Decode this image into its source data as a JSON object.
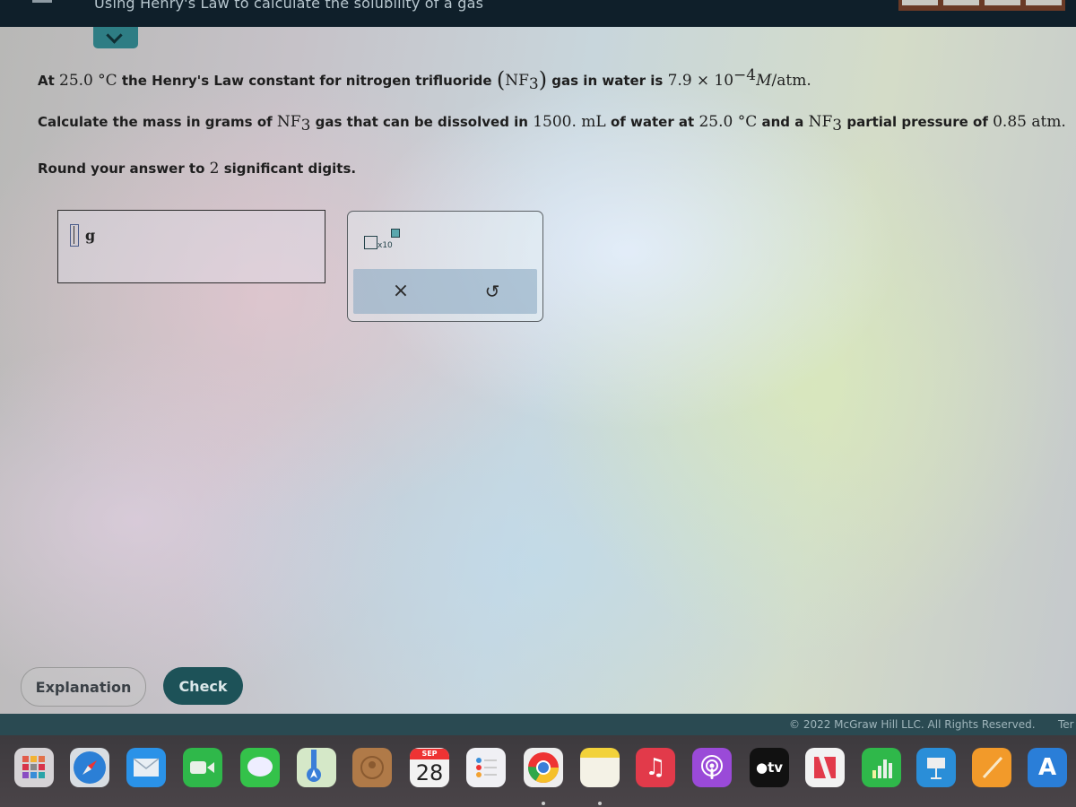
{
  "header": {
    "title": "Using Henry's Law to calculate the solubility of a gas"
  },
  "question": {
    "line1": {
      "prefix": "At",
      "temp": "25.0",
      "temp_unit": "°C",
      "text_a": "the Henry's Law constant for nitrogen trifluoride",
      "formula": "NF",
      "formula_sub": "3",
      "text_b": "gas in water is",
      "mantissa": "7.9",
      "times": "×",
      "base": "10",
      "exponent": "−4",
      "unit_M": "M",
      "unit_rest": "/atm."
    },
    "line2": {
      "text_a": "Calculate the mass in grams of",
      "formula": "NF",
      "formula_sub": "3",
      "text_b": "gas that can be dissolved in",
      "volume": "1500. mL",
      "text_c": "of water at",
      "temp": "25.0 °C",
      "text_d": "and a",
      "formula2": "NF",
      "formula2_sub": "3",
      "text_e": "partial pressure of",
      "pressure": "0.85 atm."
    },
    "line3": {
      "text_a": "Round your answer to",
      "digits": "2",
      "text_b": "significant digits."
    }
  },
  "answer": {
    "value": "",
    "unit": "g"
  },
  "tools": {
    "sci_notation_label": "x10",
    "clear_symbol": "×",
    "undo_symbol": "↺"
  },
  "buttons": {
    "explanation": "Explanation",
    "check": "Check"
  },
  "footer": {
    "copyright": "© 2022 McGraw Hill LLC. All Rights Reserved.",
    "terms": "Ter"
  },
  "dock": {
    "calendar_month": "SEP",
    "calendar_day": "28",
    "tv_label": "tv",
    "apps": [
      "Launchpad",
      "Safari",
      "Mail",
      "FaceTime",
      "Messages",
      "Maps",
      "Contacts",
      "Calendar",
      "Reminders",
      "Chrome",
      "Notes",
      "Music",
      "Podcasts",
      "TV",
      "News",
      "Numbers",
      "Keynote",
      "Pages",
      "App Store"
    ]
  },
  "colors": {
    "teal_dark": "#1d5258",
    "teal_tab": "#2e7d84",
    "topbar": "#0f1f2a"
  }
}
